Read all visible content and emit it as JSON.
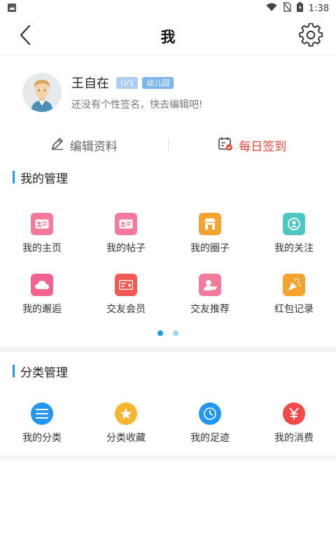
{
  "status_bar": {
    "time": "1:38"
  },
  "header": {
    "title": "我",
    "back_icon": "back-arrow-icon",
    "settings_icon": "gear-icon"
  },
  "profile": {
    "name": "王自在",
    "badges": [
      "LV1",
      "幼儿园"
    ],
    "signature": "还没有个性签名，快去编辑吧!"
  },
  "actions": {
    "edit_label": "编辑资料",
    "checkin_label": "每日签到"
  },
  "manage": {
    "title": "我的管理",
    "items": [
      {
        "label": "我的主页",
        "icon": "id-card-icon",
        "color": "#f27a9a"
      },
      {
        "label": "我的帖子",
        "icon": "post-card-icon",
        "color": "#f27a9a"
      },
      {
        "label": "我的圈子",
        "icon": "shop-icon",
        "color": "#f4a42e"
      },
      {
        "label": "我的关注",
        "icon": "follow-user-icon",
        "color": "#4cc8c0"
      },
      {
        "label": "我的邂逅",
        "icon": "cloud-icon",
        "color": "#f2648f"
      },
      {
        "label": "交友会员",
        "icon": "vip-card-icon",
        "color": "#ef5a55"
      },
      {
        "label": "交友推荐",
        "icon": "user-heart-icon",
        "color": "#f27a9a"
      },
      {
        "label": "红包记录",
        "icon": "party-popper-icon",
        "color": "#f4a42e"
      }
    ],
    "page_indicator": {
      "pages": 2,
      "active": 1
    }
  },
  "category": {
    "title": "分类管理",
    "items": [
      {
        "label": "我的分类",
        "icon": "list-icon",
        "color": "#2196f3"
      },
      {
        "label": "分类收藏",
        "icon": "star-icon",
        "color": "#f5b52e"
      },
      {
        "label": "我的足迹",
        "icon": "clock-icon",
        "color": "#2196f3"
      },
      {
        "label": "我的消费",
        "icon": "yen-icon",
        "color": "#f24a4a"
      }
    ]
  },
  "colors": {
    "accent": "#2196f3",
    "checkin": "#e4433b",
    "badge": "#a9cdf3"
  }
}
